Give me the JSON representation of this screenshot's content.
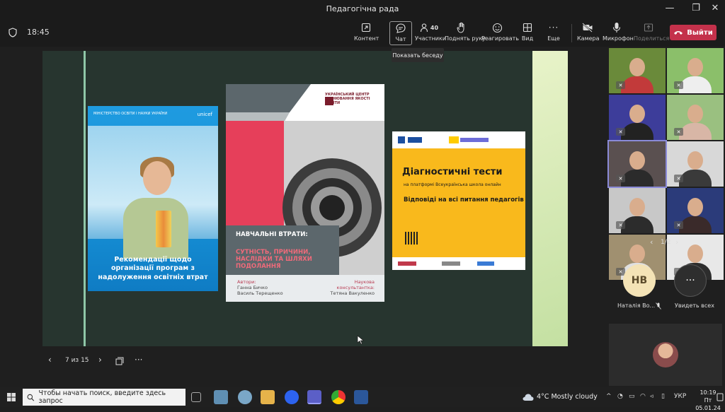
{
  "window": {
    "title": "Педагогічна рада",
    "minimize": "—",
    "maximize": "❐",
    "close": "✕"
  },
  "meeting": {
    "elapsed": "18:45",
    "toolbar": [
      {
        "name": "content",
        "label": "Контент",
        "icon": "share-screen-icon"
      },
      {
        "name": "chat",
        "label": "Чат",
        "icon": "chat-icon",
        "active": true
      },
      {
        "name": "participants",
        "label": "Участники",
        "icon": "people-icon",
        "count": "40"
      },
      {
        "name": "raise-hand",
        "label": "Поднять руку",
        "icon": "hand-icon"
      },
      {
        "name": "reactions",
        "label": "Реагировать",
        "icon": "smiley-icon"
      },
      {
        "name": "view",
        "label": "Вид",
        "icon": "grid-icon"
      },
      {
        "name": "more",
        "label": "Еще",
        "icon": "ellipsis-icon"
      },
      {
        "name": "camera",
        "label": "Камера",
        "icon": "camera-off-icon"
      },
      {
        "name": "microphone",
        "label": "Микрофон",
        "icon": "mic-icon"
      },
      {
        "name": "share",
        "label": "Поделиться",
        "icon": "share-tray-icon",
        "disabled": true
      }
    ],
    "leave_label": "Выйти",
    "tooltip": "Показать беседу",
    "accent": "#c4314b"
  },
  "presentation": {
    "page": "7 из 15",
    "book1": {
      "header": "МІНІСТЕРСТВО ОСВІТИ І НАУКИ УКРАЇНИ",
      "logo": "unicef",
      "title": "Рекомендації щодо організації програм з надолуження освітніх втрат"
    },
    "book2": {
      "brand": "УКРАЇНСЬКИЙ ЦЕНТР ОЦІНЮВАННЯ ЯКОСТІ ОСВІТИ",
      "title1": "НАВЧАЛЬНІ ВТРАТИ:",
      "title2": "СУТНІСТЬ, ПРИЧИНИ, НАСЛІДКИ ТА ШЛЯХИ ПОДОЛАННЯ",
      "authors_label": "Автори:",
      "authors": "Ганна Бичко\nВасиль Терещенко",
      "consultant_label": "Наукова консультантка:",
      "consultant": "Тетяна Вакуленко"
    },
    "book3": {
      "heading": "Діагностичні тести",
      "subheading": "на платформі Всеукраїнська школа онлайн",
      "body": "Відповіді на всі питання педагогів"
    }
  },
  "participants": {
    "pager": "1/2",
    "tiles": [
      {
        "bg": "#6a8a3a",
        "shirt": "#c23a3a"
      },
      {
        "bg": "#8bbf6a",
        "shirt": "#eeeeee"
      },
      {
        "bg": "#3d3d9a",
        "shirt": "#222222"
      },
      {
        "bg": "#9ac080",
        "shirt": "#d8b6a6"
      },
      {
        "bg": "#5a5050",
        "shirt": "#2b2b2b"
      },
      {
        "bg": "#d8d8d8",
        "shirt": "#3a3a3a"
      },
      {
        "bg": "#c8c8c8",
        "shirt": "#2c2c2c"
      },
      {
        "bg": "#2b3b7a",
        "shirt": "#3a2a2a"
      },
      {
        "bg": "#a09070",
        "shirt": "#e0e0e0"
      },
      {
        "bg": "#e8e8e8",
        "shirt": "#2d2d2d"
      }
    ],
    "avatar_initials": "НВ",
    "avatar_name": "Наталія Во...",
    "see_all": "Увидеть всех"
  },
  "taskbar": {
    "search_placeholder": "Чтобы начать поиск, введите здесь запрос",
    "weather": "4°C  Mostly cloudy",
    "lang": "УКР",
    "time": "10:19",
    "date": "Пт 05.01.24"
  }
}
